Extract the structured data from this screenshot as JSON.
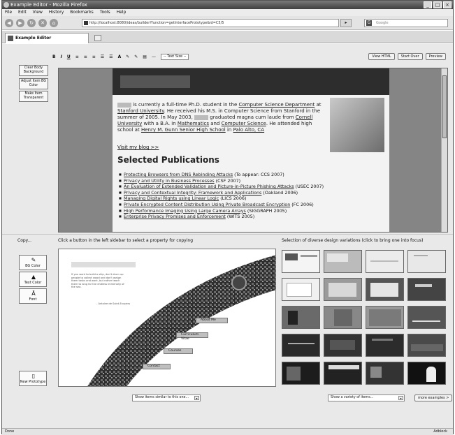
{
  "window": {
    "title": "Example Editor - Mozilla Firefox",
    "buttons": [
      "_",
      "□",
      "×"
    ]
  },
  "menu": [
    "File",
    "Edit",
    "View",
    "History",
    "Bookmarks",
    "Tools",
    "Help"
  ],
  "nav": {
    "url": "http://localhost:8080/ideas/builder?function=getInterfacePrototype&id=C5/5",
    "search_placeholder": "Google",
    "search_engine_glyph": "G"
  },
  "tab": {
    "label": "Example Editor"
  },
  "toolbar": {
    "format_buttons": [
      "B",
      "I",
      "U",
      "≡",
      "≡",
      "≡",
      "☰",
      "☰",
      "A",
      "✎",
      "✎",
      "▤",
      "—"
    ],
    "text_size": "-- Text Size --",
    "view_html": "View HTML",
    "start_over": "Start Over",
    "preview": "Preview"
  },
  "sidebar_top": {
    "clear_bg": "Clear Body Background",
    "adjust_bg": "Adjust Item BG Color",
    "make_transparent": "Make Item Transparent"
  },
  "preview": {
    "bio_1": " is currently a full-time Ph.D. student in the ",
    "bio_link_csdept": "Computer Science Department",
    "bio_2": " at ",
    "bio_link_stanford": "Stanford University",
    "bio_3": ". He received his M.S. in Computer Science from Stanford in the summer of 2005. In May 2003, ",
    "bio_4": " graduated magna cum laude from ",
    "bio_link_cornell": "Cornell University",
    "bio_5": " with a B.A. in ",
    "bio_link_math": "Mathematics",
    "bio_6": " and ",
    "bio_link_cs": "Computer Science",
    "bio_7": ". He attended high school at ",
    "bio_link_gunn": "Henry M. Gunn Senior High School",
    "bio_8": " in ",
    "bio_link_paloalto": "Palo Alto, CA",
    "blog_link": "Visit my blog >>",
    "heading": "Selected Publications",
    "publications": [
      {
        "link": "Protecting Browsers from DNS Rebinding Attacks",
        "note": " (To appear: CCS 2007)"
      },
      {
        "link": "Privacy and Utility in Business Processes",
        "note": " (CSF 2007)"
      },
      {
        "link": "An Evaluation of Extended Validation and Picture-in-Picture Phishing Attacks",
        "note": " (USEC 2007)"
      },
      {
        "link": "Privacy and Contextual Integrity: Framework and Applications",
        "note": " (Oakland 2006)"
      },
      {
        "link": "Managing Digital Rights using Linear Logic",
        "note": " (LICS 2006)"
      },
      {
        "link": "Private Encrypted Content Distribution Using Private Broadcast Encryption",
        "note": " (FC 2006)"
      },
      {
        "link": "High Performance Imaging Using Large Camera Arrays",
        "note": " (SIGGRAPH 2005)"
      },
      {
        "link": "Enterprise Privacy Promises and Enforcement",
        "note": " (WITS 2005)"
      }
    ]
  },
  "copy_panel": {
    "label": "Copy...",
    "bg_color": "BG Color",
    "text_color": "Text Color",
    "font": "Font",
    "new_prototype": "New Prototype"
  },
  "instructions": {
    "left": "Click a button in the left sidebar to select a property for copying",
    "right": "Selection of diverse design variations (click to bring one into focus)"
  },
  "collage": {
    "quote": "If you want to build a ship, don't drum up people to collect wood and don't assign them tasks and work, but rather teach them to long for the endless immensity of the sea.",
    "quote_author": "- Antoine de Saint-Exupery",
    "menu": [
      "About Me",
      "Curriculum Vitae",
      "Courses",
      "Contact"
    ]
  },
  "bottom": {
    "similar": "Show items similar to this one...",
    "variety": "Show a variety of items...",
    "more": "more examples >"
  },
  "status": {
    "left": "Done",
    "right": "Adblock"
  },
  "colors": {
    "page_bg": "#e9e9e9",
    "preview_bg": "#858585",
    "header_dark": "#2d2d2d"
  }
}
